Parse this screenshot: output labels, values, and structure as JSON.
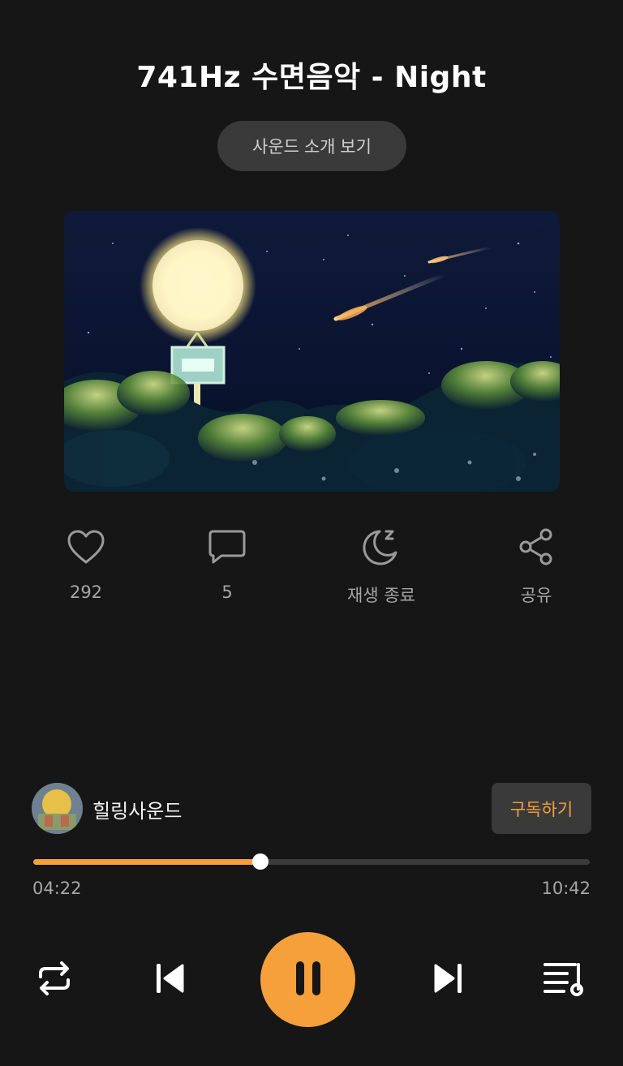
{
  "track": {
    "title": "741Hz 수면음악 - Night",
    "intro_button_label": "사운드 소개 보기"
  },
  "actions": {
    "like": {
      "icon": "heart-icon",
      "label": "292"
    },
    "comment": {
      "icon": "comment-icon",
      "label": "5"
    },
    "sleep_timer": {
      "icon": "moon-sleep-icon",
      "label": "재생 종료"
    },
    "share": {
      "icon": "share-icon",
      "label": "공유"
    }
  },
  "channel": {
    "name": "힐링사운드",
    "subscribe_label": "구독하기"
  },
  "player": {
    "elapsed": "04:22",
    "total": "10:42",
    "progress_fraction": 0.408,
    "controls": [
      "repeat-icon",
      "previous-icon",
      "pause-icon",
      "next-icon",
      "playlist-icon"
    ]
  },
  "colors": {
    "background": "#161616",
    "accent": "#f5a03a",
    "button_bg": "#3a3a3a",
    "muted_text": "#a6a6a6"
  }
}
